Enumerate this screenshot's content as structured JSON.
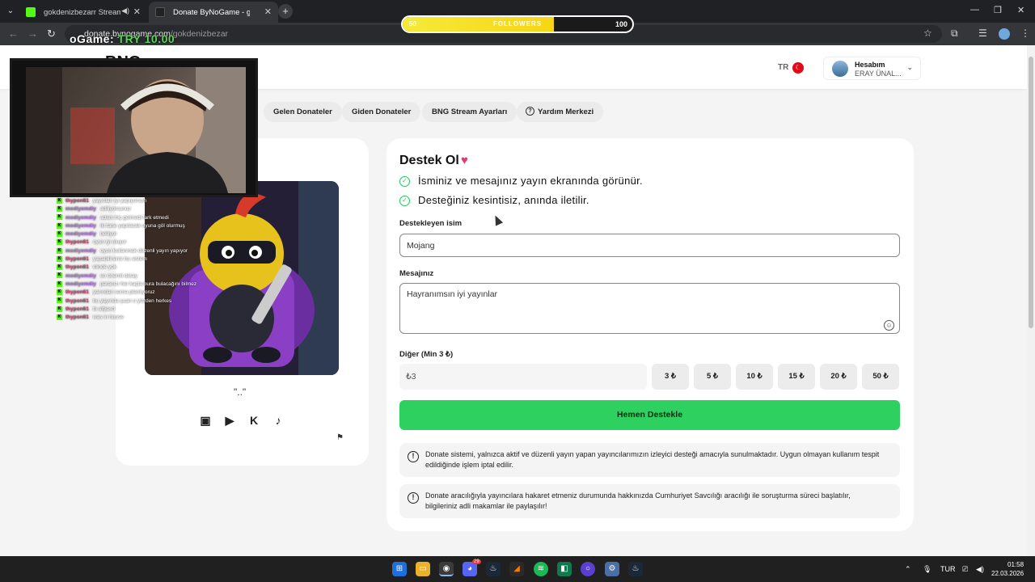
{
  "browser": {
    "tabs": [
      {
        "title": "gokdenizbezarr Stream - W",
        "active": false,
        "icon": "kick-icon",
        "muted_icon": "speaker-icon"
      },
      {
        "title": "Donate ByNoGame - gokdenizb",
        "active": true,
        "icon": "bynogame-icon"
      }
    ],
    "url_host": "donate.bynogame.com",
    "url_path": "/gokdenizbezar"
  },
  "overlay": {
    "left_value": "50",
    "label": "FOLLOWERS",
    "right_value": "100",
    "progress": 0.66,
    "nogame_prefix": "oGame:",
    "nogame_amount": "TRY 10.00"
  },
  "header": {
    "logo_text": "BNG",
    "lang": "TR",
    "account_title": "Hesabım",
    "account_name": "ERAY ÜNAL..."
  },
  "nav": {
    "items": [
      "Gelen Donateler",
      "Giden Donateler",
      "BNG Stream Ayarları",
      "Yardım Merkezi"
    ]
  },
  "profile": {
    "name": "\"..\"",
    "socials": [
      "twitch-icon",
      "youtube-icon",
      "kick-icon",
      "tiktok-icon"
    ]
  },
  "chat": [
    {
      "user": "thypon61",
      "msg": "yayınları iyi yapıyorsun",
      "t": true
    },
    {
      "user": "modiyemdiy",
      "msg": "adiliyorsunuz",
      "t": false
    },
    {
      "user": "modiyemdiy",
      "msg": "adam hiç gelmedi fark etmedi",
      "t": false
    },
    {
      "user": "modiyemdiy",
      "msg": "iki tane yapılacak oyuna göl olurmuş",
      "t": false
    },
    {
      "user": "modiyemdiy",
      "msg": "belliyor",
      "t": false
    },
    {
      "user": "thypon61",
      "msg": "oyun iyi oluyor",
      "t": true
    },
    {
      "user": "modiyemdiy",
      "msg": "oyun kullanmak düzenli yayın yapıyor",
      "t": false
    },
    {
      "user": "thypon61",
      "msg": "yapabilirsiniz bu sistem",
      "t": true
    },
    {
      "user": "thypon61",
      "msg": "elinde yok",
      "t": true
    },
    {
      "user": "modiyemdiy",
      "msg": "en önemli detay",
      "t": false
    },
    {
      "user": "modiyemdiy",
      "msg": "paranızı her kaçta bura bulacağını bilmez",
      "t": false
    },
    {
      "user": "thypon61",
      "msg": "yarından sonra planlıyoruz",
      "t": true
    },
    {
      "user": "thypon61",
      "msg": "bu yayında şuan o yüzden herkes",
      "t": true
    },
    {
      "user": "thypon61",
      "msg": "bi alfjiasd",
      "t": true
    },
    {
      "user": "thypon61",
      "msg": "was in house",
      "t": true
    }
  ],
  "form": {
    "title": "Destek Ol",
    "checks": [
      "İsminiz ve mesajınız yayın ekranında görünür.",
      "Desteğiniz kesintisiz, anında iletilir."
    ],
    "name_label": "Destekleyen isim",
    "name_value": "Mojang",
    "message_label": "Mesajınız",
    "message_value": "Hayranımsın iyi yayınlar",
    "amount_label": "Diğer (Min 3 ₺)",
    "amount_value": "₺3",
    "amount_options": [
      "3 ₺",
      "5 ₺",
      "10 ₺",
      "15 ₺",
      "20 ₺",
      "50 ₺"
    ],
    "submit_label": "Hemen Destekle",
    "notices": [
      "Donate sistemi, yalnızca aktif ve düzenli yayın yapan yayıncılarımızın izleyici desteği amacıyla sunulmaktadır. Uygun olmayan kullanım tespit edildiğinde işlem iptal edilir.",
      "Donate aracılığıyla yayıncılara hakaret etmeniz durumunda hakkınızda Cumhuriyet Savcılığı aracılığı ile soruşturma süreci başlatılır, bilgileriniz adli makamlar ile paylaşılır!"
    ]
  },
  "taskbar": {
    "lang": "TUR",
    "time": "01:58",
    "date": "22.03.2026",
    "discord_badge": "29"
  },
  "colors": {
    "accent_green": "#2ed15f",
    "check_green": "#22c55e",
    "heart": "#e33a77",
    "overlay_yellow": "#f5ea3a"
  }
}
